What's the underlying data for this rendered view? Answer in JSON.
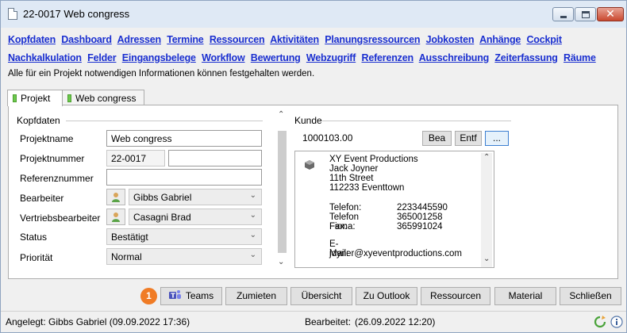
{
  "window": {
    "title": "22-0017 Web congress"
  },
  "nav": {
    "row1": [
      "Kopfdaten",
      "Dashboard",
      "Adressen",
      "Termine",
      "Ressourcen",
      "Aktivitäten",
      "Planungsressourcen",
      "Jobkosten",
      "Anhänge",
      "Cockpit"
    ],
    "row2": [
      "Nachkalkulation",
      "Felder",
      "Eingangsbelege",
      "Workflow",
      "Bewertung",
      "Webzugriff",
      "Referenzen",
      "Ausschreibung",
      "Zeiterfassung",
      "Räume"
    ],
    "hint": "Alle für ein Projekt notwendigen Informationen können festgehalten werden."
  },
  "tabs": [
    {
      "label": "Projekt"
    },
    {
      "label": "Web congress"
    }
  ],
  "kopfdaten": {
    "group_title": "Kopfdaten",
    "projektname_label": "Projektname",
    "projektname_value": "Web congress",
    "projektnummer_label": "Projektnummer",
    "projektnummer_value": "22-0017",
    "projektnummer_extra": "",
    "referenznummer_label": "Referenznummer",
    "referenznummer_value": "",
    "bearbeiter_label": "Bearbeiter",
    "bearbeiter_value": "Gibbs Gabriel",
    "vertrieb_label": "Vertriebsbearbeiter",
    "vertrieb_value": "Casagni Brad",
    "status_label": "Status",
    "status_value": "Bestätigt",
    "prioritaet_label": "Priorität",
    "prioritaet_value": "Normal"
  },
  "kunde": {
    "group_title": "Kunde",
    "number": "1000103.00",
    "btn_bea": "Bea",
    "btn_entf": "Entf",
    "btn_more": "...",
    "address_lines": [
      "XY Event Productions",
      "Jack Joyner",
      "11th Street",
      "112233 Eventtown"
    ],
    "contacts": [
      {
        "key": "Telefon:",
        "value": "2233445590"
      },
      {
        "key": "Telefon Firma:",
        "value": "365001258"
      },
      {
        "key": "Fax:",
        "value": "365991024"
      }
    ],
    "email_label": "E-Mail:",
    "email_value": "joyner@xyeventproductions.com"
  },
  "toolbar": {
    "badge": "1",
    "teams": "Teams",
    "zumieten": "Zumieten",
    "uebersicht": "Übersicht",
    "zu_outlook": "Zu Outlook",
    "ressourcen": "Ressourcen",
    "material": "Material",
    "schliessen": "Schließen"
  },
  "status": {
    "created": "Angelegt: Gibbs Gabriel (09.09.2022 17:36)",
    "edited_label": "Bearbeitet:",
    "edited_value": "(26.09.2022 12:20)"
  },
  "colors": {
    "link": "#1a2fd0",
    "badge": "#f07c26",
    "title_bar": "#dfe9f5"
  }
}
